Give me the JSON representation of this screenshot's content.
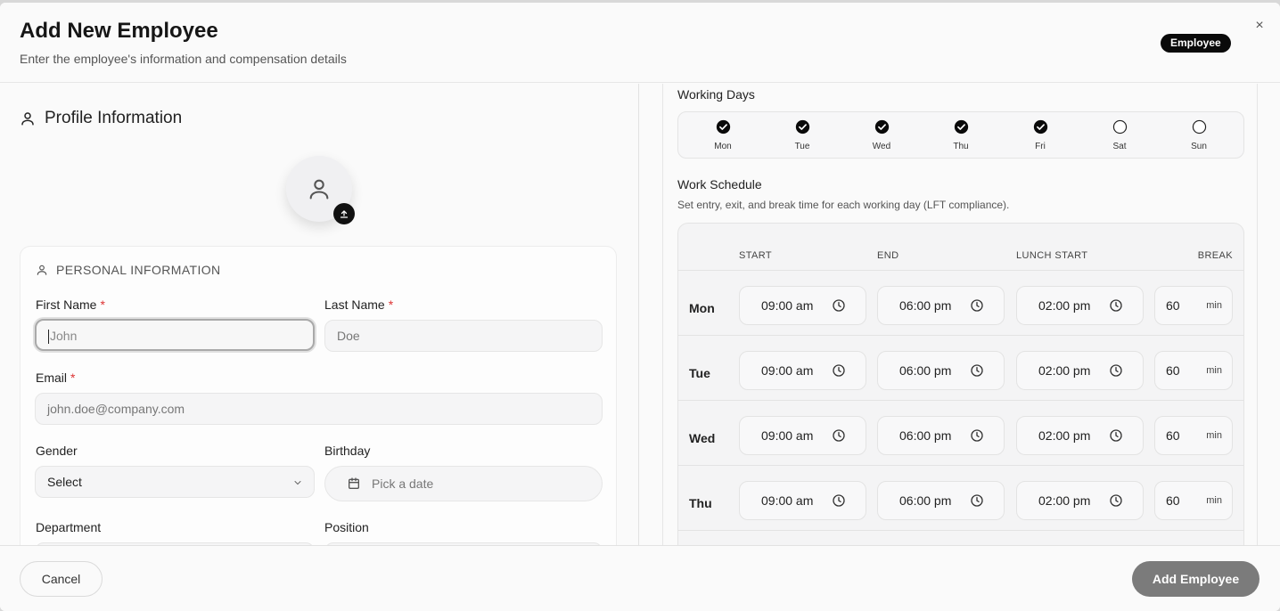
{
  "header": {
    "title": "Add New Employee",
    "subtitle": "Enter the employee's information and compensation details",
    "role_badge": "Employee",
    "close_icon": "×"
  },
  "profile": {
    "section_title": "Profile Information",
    "personal_header": "PERSONAL INFORMATION",
    "fields": {
      "first_name": {
        "label": "First Name",
        "required": "*",
        "value": "John"
      },
      "last_name": {
        "label": "Last Name",
        "required": "*",
        "placeholder": "Doe"
      },
      "email": {
        "label": "Email",
        "required": "*",
        "placeholder": "john.doe@company.com"
      },
      "gender": {
        "label": "Gender",
        "value": "Select"
      },
      "birthday": {
        "label": "Birthday",
        "placeholder": "Pick a date"
      },
      "department": {
        "label": "Department"
      },
      "position": {
        "label": "Position"
      }
    }
  },
  "working_days": {
    "label": "Working Days",
    "days": [
      {
        "name": "Mon",
        "checked": true
      },
      {
        "name": "Tue",
        "checked": true
      },
      {
        "name": "Wed",
        "checked": true
      },
      {
        "name": "Thu",
        "checked": true
      },
      {
        "name": "Fri",
        "checked": true
      },
      {
        "name": "Sat",
        "checked": false
      },
      {
        "name": "Sun",
        "checked": false
      }
    ]
  },
  "work_schedule": {
    "label": "Work Schedule",
    "note": "Set entry, exit, and break time for each working day (LFT compliance).",
    "columns": [
      "START",
      "END",
      "LUNCH START",
      "BREAK"
    ],
    "break_unit": "min",
    "rows": [
      {
        "day": "Mon",
        "start": "09:00 am",
        "end": "06:00 pm",
        "lunch": "02:00 pm",
        "break": "60"
      },
      {
        "day": "Tue",
        "start": "09:00 am",
        "end": "06:00 pm",
        "lunch": "02:00 pm",
        "break": "60"
      },
      {
        "day": "Wed",
        "start": "09:00 am",
        "end": "06:00 pm",
        "lunch": "02:00 pm",
        "break": "60"
      },
      {
        "day": "Thu",
        "start": "09:00 am",
        "end": "06:00 pm",
        "lunch": "02:00 pm",
        "break": "60"
      }
    ]
  },
  "footer": {
    "cancel_label": "Cancel",
    "submit_label": "Add Employee"
  },
  "icons": {
    "close": "close-icon",
    "user": "user-icon",
    "upload": "upload-icon",
    "chevron": "chevron-down-icon",
    "calendar": "calendar-icon",
    "clock": "clock-icon",
    "check": "check-circle-icon"
  }
}
